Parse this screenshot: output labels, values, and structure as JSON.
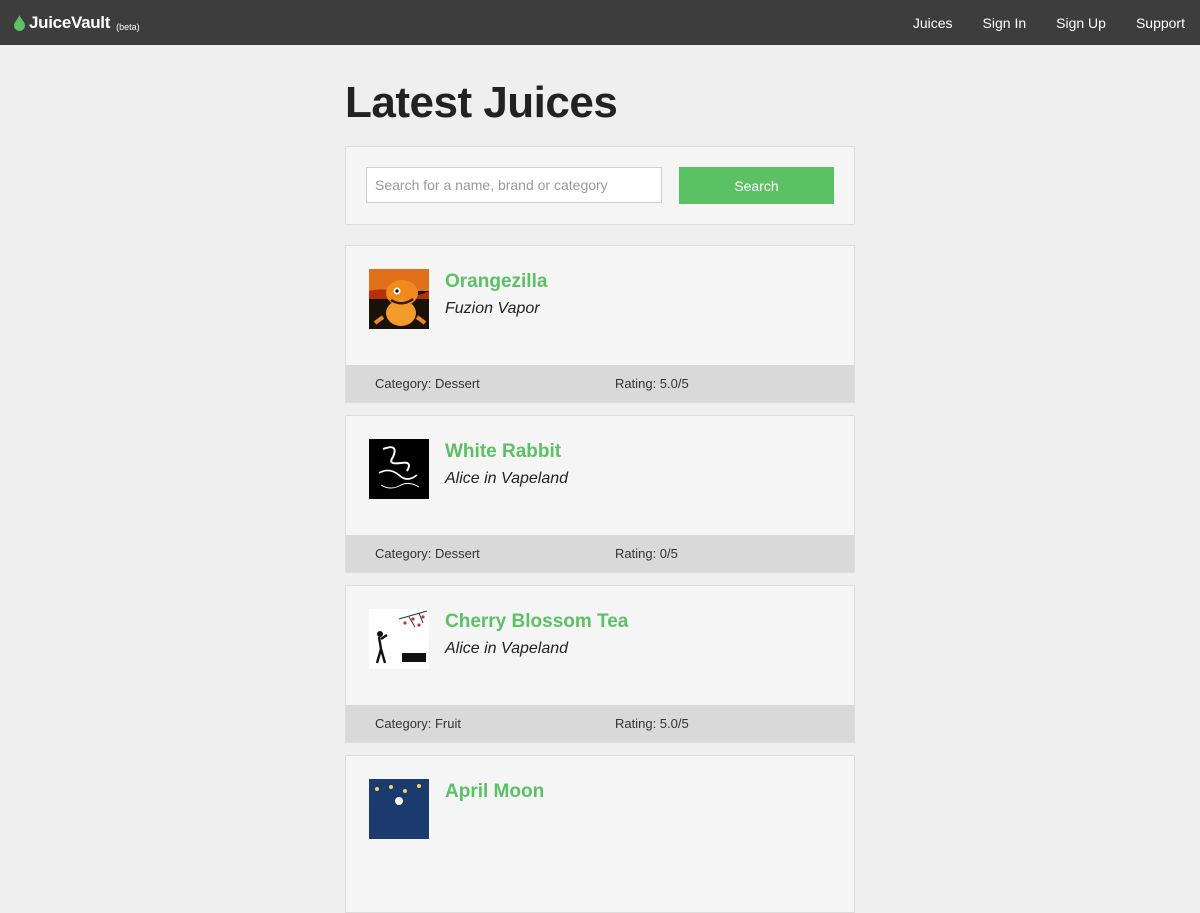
{
  "nav": {
    "brand": "JuiceVault",
    "brand_tag": "(beta)",
    "links": [
      "Juices",
      "Sign In",
      "Sign Up",
      "Support"
    ]
  },
  "page": {
    "title": "Latest Juices"
  },
  "search": {
    "placeholder": "Search for a name, brand or category",
    "value": "",
    "button": "Search"
  },
  "juices": [
    {
      "name": "Orangezilla",
      "brand": "Fuzion Vapor",
      "category": "Category: Dessert",
      "rating": "Rating: 5.0/5",
      "image_icon": "orange-monster-icon"
    },
    {
      "name": "White Rabbit",
      "brand": "Alice in Vapeland",
      "category": "Category: Dessert",
      "rating": "Rating: 0/5",
      "image_icon": "white-rabbit-icon"
    },
    {
      "name": "Cherry Blossom Tea",
      "brand": "Alice in Vapeland",
      "category": "Category: Fruit",
      "rating": "Rating: 5.0/5",
      "image_icon": "cherry-blossom-icon"
    },
    {
      "name": "April Moon",
      "brand": "",
      "category": "",
      "rating": "",
      "image_icon": "starry-night-icon"
    }
  ],
  "colors": {
    "accent": "#5bc164",
    "navbar": "#3d3d3d",
    "background": "#efefef",
    "footer": "#d9d9d9"
  }
}
